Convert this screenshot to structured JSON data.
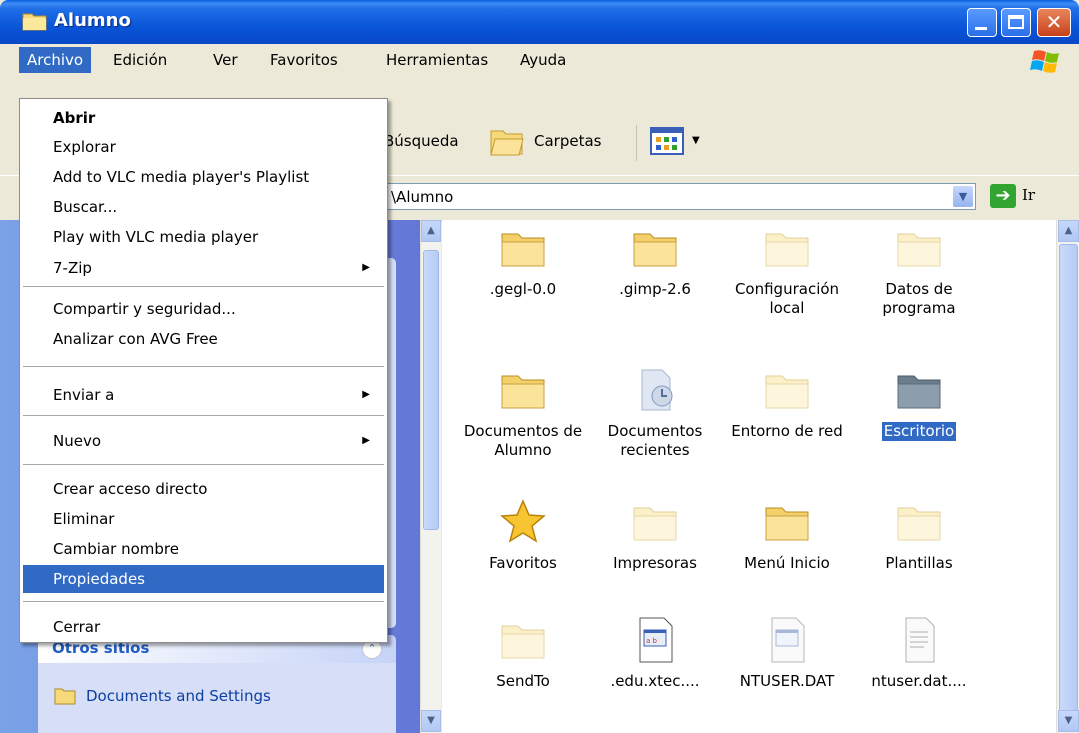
{
  "window": {
    "title": "Alumno"
  },
  "menubar": {
    "items": [
      "Archivo",
      "Edición",
      "Ver",
      "Favoritos",
      "Herramientas",
      "Ayuda"
    ]
  },
  "toolbar": {
    "busqueda": "Búsqueda",
    "carpetas": "Carpetas"
  },
  "address": {
    "value": "\\Alumno",
    "go_label": "Ir"
  },
  "archivo_menu": {
    "items": [
      {
        "label": "Abrir",
        "bold": true
      },
      {
        "label": "Explorar"
      },
      {
        "label": "Add to VLC media player's Playlist"
      },
      {
        "label": "Buscar..."
      },
      {
        "label": "Play with VLC media player"
      },
      {
        "label": "7-Zip",
        "submenu": true
      },
      {
        "label": "Compartir y seguridad..."
      },
      {
        "label": "Analizar con AVG Free"
      },
      {
        "label": "Enviar a",
        "submenu": true
      },
      {
        "label": "Nuevo",
        "submenu": true
      },
      {
        "label": "Crear acceso directo"
      },
      {
        "label": "Eliminar"
      },
      {
        "label": "Cambiar nombre"
      },
      {
        "label": "Propiedades",
        "highlighted": true
      },
      {
        "label": "Cerrar"
      }
    ]
  },
  "taskpane": {
    "otros_sitios": {
      "title": "Otros sitios",
      "links": [
        "Documents and Settings"
      ]
    }
  },
  "files": [
    {
      "name": ".gegl-0.0",
      "icon": "folder-icon"
    },
    {
      "name": ".gimp-2.6",
      "icon": "folder-icon"
    },
    {
      "name": "Configuración local",
      "icon": "folder-hidden-icon"
    },
    {
      "name": "Datos de programa",
      "icon": "folder-hidden-icon"
    },
    {
      "name": "Documentos de Alumno",
      "icon": "folder-icon"
    },
    {
      "name": "Documentos recientes",
      "icon": "recent-docs-icon"
    },
    {
      "name": "Entorno de red",
      "icon": "folder-hidden-icon"
    },
    {
      "name": "Escritorio",
      "icon": "desktop-folder-icon",
      "selected": true
    },
    {
      "name": "Favoritos",
      "icon": "star-icon"
    },
    {
      "name": "Impresoras",
      "icon": "folder-hidden-icon"
    },
    {
      "name": "Menú Inicio",
      "icon": "folder-icon"
    },
    {
      "name": "Plantillas",
      "icon": "folder-hidden-icon"
    },
    {
      "name": "SendTo",
      "icon": "folder-hidden-icon"
    },
    {
      "name": ".edu.xtec....",
      "icon": "dat-file-icon"
    },
    {
      "name": "NTUSER.DAT",
      "icon": "dat-file-hidden-icon"
    },
    {
      "name": "ntuser.dat....",
      "icon": "text-file-icon"
    }
  ],
  "colors": {
    "titlebar": "#0a55d8",
    "selection": "#316ac5",
    "taskpane": "#7ba2e7"
  }
}
